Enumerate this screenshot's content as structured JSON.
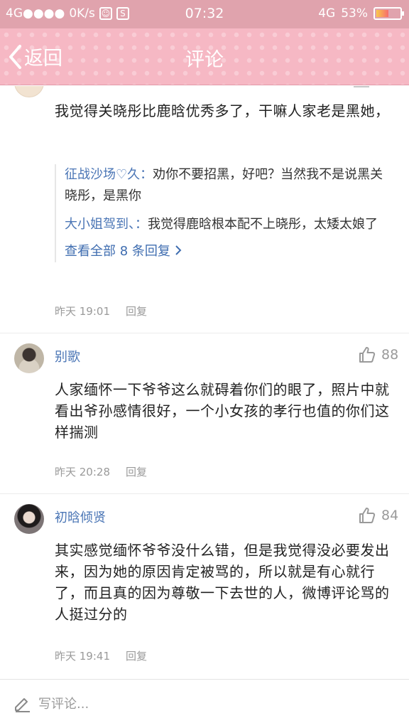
{
  "status_bar": {
    "network": "4G●●●●",
    "speed": "0K/s",
    "time": "07:32",
    "net_type": "4G",
    "battery": "53%",
    "battery_level": 0.53
  },
  "header": {
    "back_label": "返回",
    "title": "评论"
  },
  "comments": [
    {
      "text": "我觉得关晓彤比鹿晗优秀多了，干嘛人家老是黑她，",
      "replies": [
        {
          "author": "征战沙场♡久：",
          "text": "劝你不要招黑，好吧？当然我不是说黑关晓彤，是黑你"
        },
        {
          "author": "大小姐驾到、：",
          "text": "我觉得鹿晗根本配不上晓彤，太矮太娘了"
        }
      ],
      "view_all": "查看全部 8 条回复",
      "time": "昨天 19:01",
      "reply_label": "回复"
    },
    {
      "author": "别歌",
      "likes": "88",
      "text": "人家缅怀一下爷爷这么就碍着你们的眼了，照片中就看出爷孙感情很好，一个小女孩的孝行也值的你们这样揣测",
      "time": "昨天 20:28",
      "reply_label": "回复"
    },
    {
      "author": "初晗倾贤",
      "likes": "84",
      "text": "其实感觉缅怀爷爷没什么错，但是我觉得没必要发出来，因为她的原因肯定被骂的，所以就是有心就行了，而且真的因为尊敬一下去世的人，微博评论骂的人挺过分的",
      "time": "昨天 19:41",
      "reply_label": "回复"
    }
  ],
  "compose": {
    "placeholder": "写评论..."
  }
}
